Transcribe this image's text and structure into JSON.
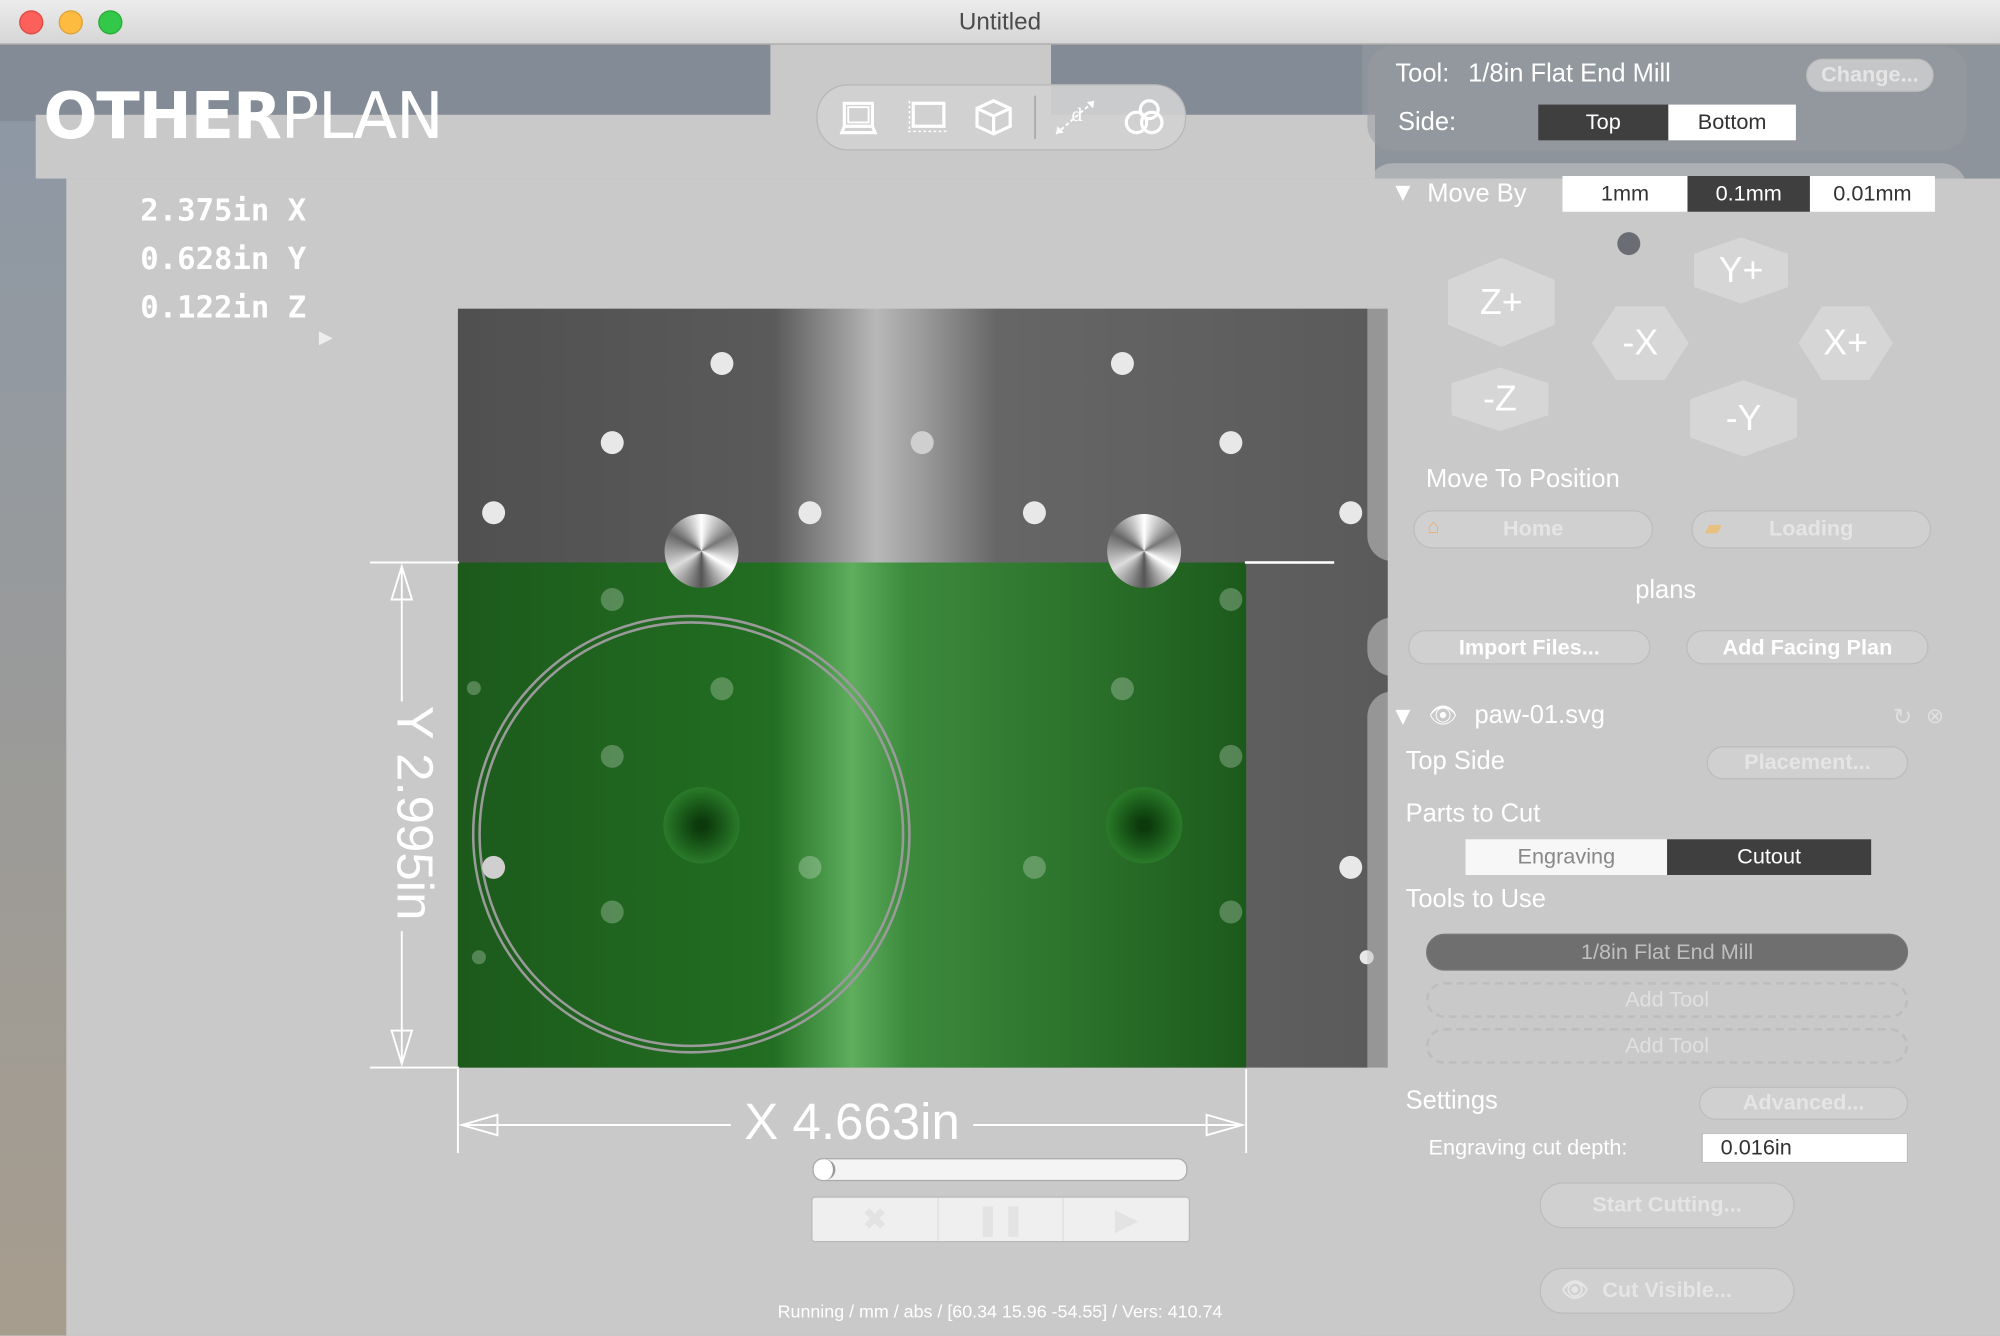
{
  "window": {
    "title": "Untitled"
  },
  "logo": {
    "text_bold": "OTHER",
    "text_light": "PLAN"
  },
  "toolbar": {
    "icons": [
      "top-view-icon",
      "front-view-icon",
      "3d-view-icon",
      "measure-icon",
      "tabs-icon"
    ],
    "measure_glyph": "d"
  },
  "coords": {
    "x": "2.375in X",
    "y": "0.628in Y",
    "z": "0.122in Z"
  },
  "workarea": {
    "dim_y": "Y 2.995in",
    "dim_x": "X 4.663in",
    "progress": 0.05
  },
  "transport": {
    "stop": "✖",
    "pause": "❚❚",
    "play": "▶"
  },
  "status": {
    "text": "Running / mm / abs / [60.34 15.96 -54.55] / Vers: 410.74"
  },
  "tool_panel": {
    "tool_label": "Tool:",
    "tool_value": "1/8in Flat End Mill",
    "change_button": "Change...",
    "side_label": "Side:",
    "side_options": [
      "Top",
      "Bottom"
    ],
    "side_selected": "Top"
  },
  "jog_panel": {
    "move_by_label": "Move By",
    "move_by_options": [
      "1mm",
      "0.1mm",
      "0.01mm"
    ],
    "move_by_selected": "0.1mm",
    "buttons": {
      "zplus": "Z+",
      "zminus": "-Z",
      "xminus": "-X",
      "xplus": "X+",
      "yplus": "Y+",
      "yminus": "-Y"
    },
    "move_to_label": "Move To Position",
    "home_button": "Home",
    "loading_button": "Loading"
  },
  "plans": {
    "heading": "plans",
    "import_button": "Import Files...",
    "facing_button": "Add Facing Plan"
  },
  "plan_item": {
    "file_name": "paw-01.svg",
    "side_label": "Top Side",
    "placement_button": "Placement...",
    "parts_label": "Parts to Cut",
    "parts_options": [
      "Engraving",
      "Cutout"
    ],
    "parts_selected": "Cutout",
    "tools_label": "Tools to Use",
    "tool_1": "1/8in Flat End Mill",
    "add_tool_1": "Add Tool",
    "add_tool_2": "Add Tool",
    "settings_label": "Settings",
    "advanced_button": "Advanced...",
    "depth_label": "Engraving cut depth:",
    "depth_value": "0.016in",
    "start_button": "Start Cutting..."
  },
  "cut_visible": {
    "button": "Cut Visible..."
  }
}
